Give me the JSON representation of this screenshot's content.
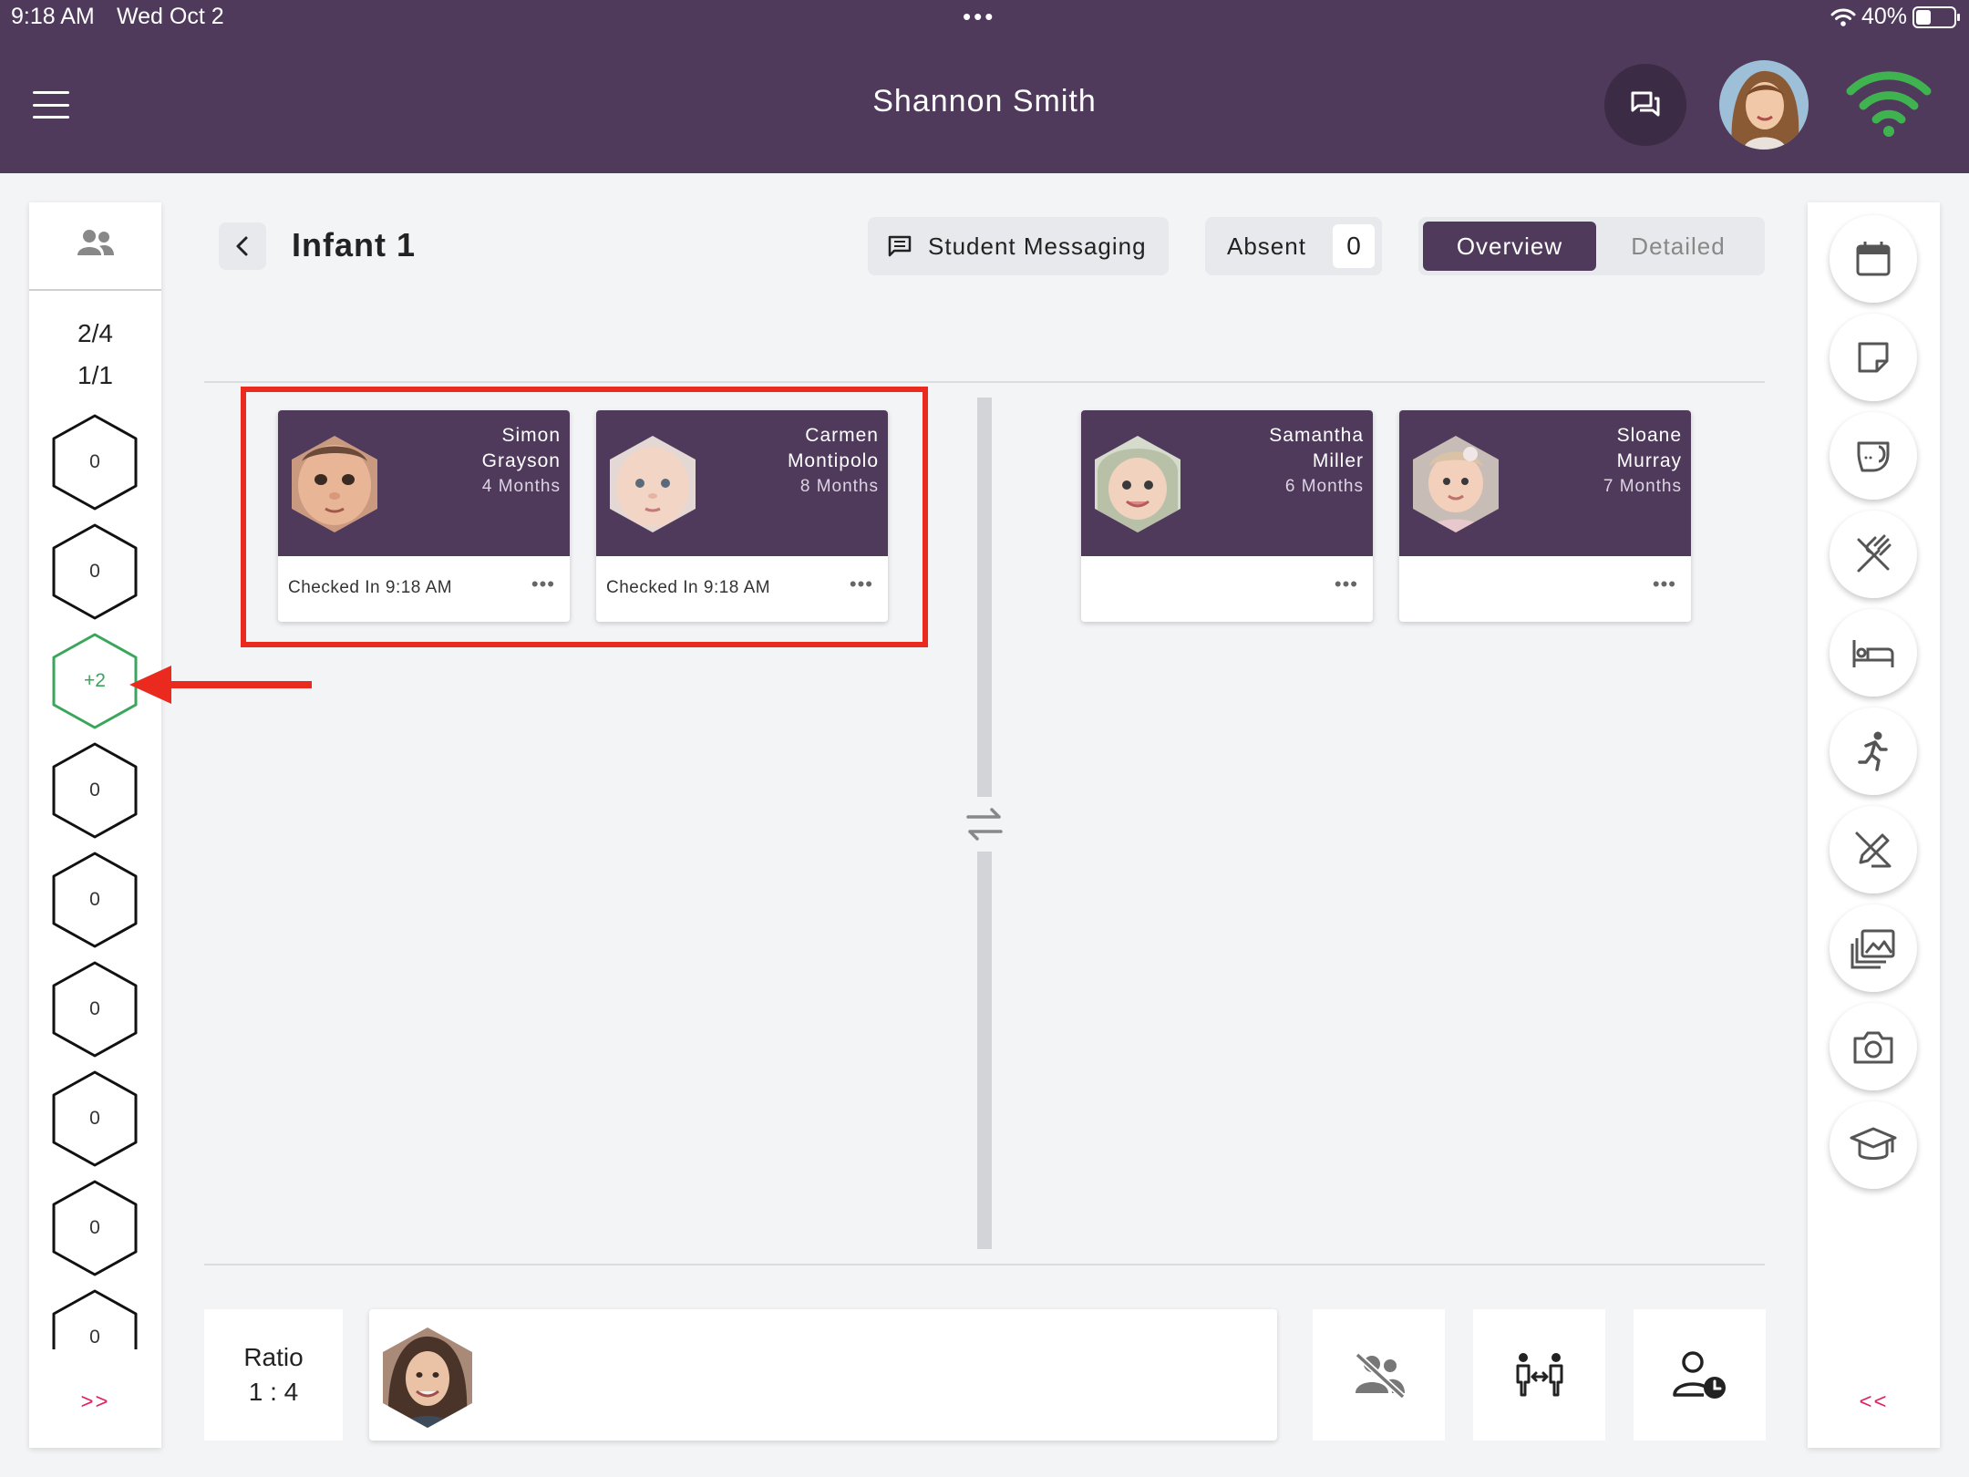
{
  "status_bar": {
    "time": "9:18 AM",
    "date": "Wed Oct 2",
    "dots": "•••",
    "battery": "40%"
  },
  "header": {
    "title": "Shannon Smith"
  },
  "left_rail": {
    "ratio_children": "2/4",
    "ratio_staff": "1/1",
    "groups": [
      "0",
      "0",
      "+2",
      "0",
      "0",
      "0",
      "0",
      "0",
      "0"
    ],
    "expand_label": ">>"
  },
  "right_rail": {
    "tools": [
      "calendar-icon",
      "note-icon",
      "diaper-icon",
      "meal-icon",
      "nap-icon",
      "activity-icon",
      "incident-icon",
      "gallery-icon",
      "camera-icon",
      "learning-icon"
    ],
    "collapse_label": "<<"
  },
  "topbar": {
    "room_name": "Infant 1",
    "student_messaging": "Student Messaging",
    "absent_label": "Absent",
    "absent_count": "0",
    "overview": "Overview",
    "detailed": "Detailed"
  },
  "students": [
    {
      "first": "Simon",
      "last": "Grayson",
      "age": "4 Months",
      "status": "Checked In 9:18 AM",
      "more": "•••"
    },
    {
      "first": "Carmen",
      "last": "Montipolo",
      "age": "8 Months",
      "status": "Checked In 9:18 AM",
      "more": "•••"
    },
    {
      "first": "Samantha",
      "last": "Miller",
      "age": "6 Months",
      "status": "",
      "more": "•••"
    },
    {
      "first": "Sloane",
      "last": "Murray",
      "age": "7 Months",
      "status": "",
      "more": "•••"
    }
  ],
  "bottom": {
    "ratio_label": "Ratio",
    "ratio_value": "1 : 4"
  },
  "colors": {
    "primary": "#4f3a5c",
    "accent_green": "#3aa65b",
    "annotation_red": "#ea2a1e",
    "link_pink": "#e0245e"
  }
}
